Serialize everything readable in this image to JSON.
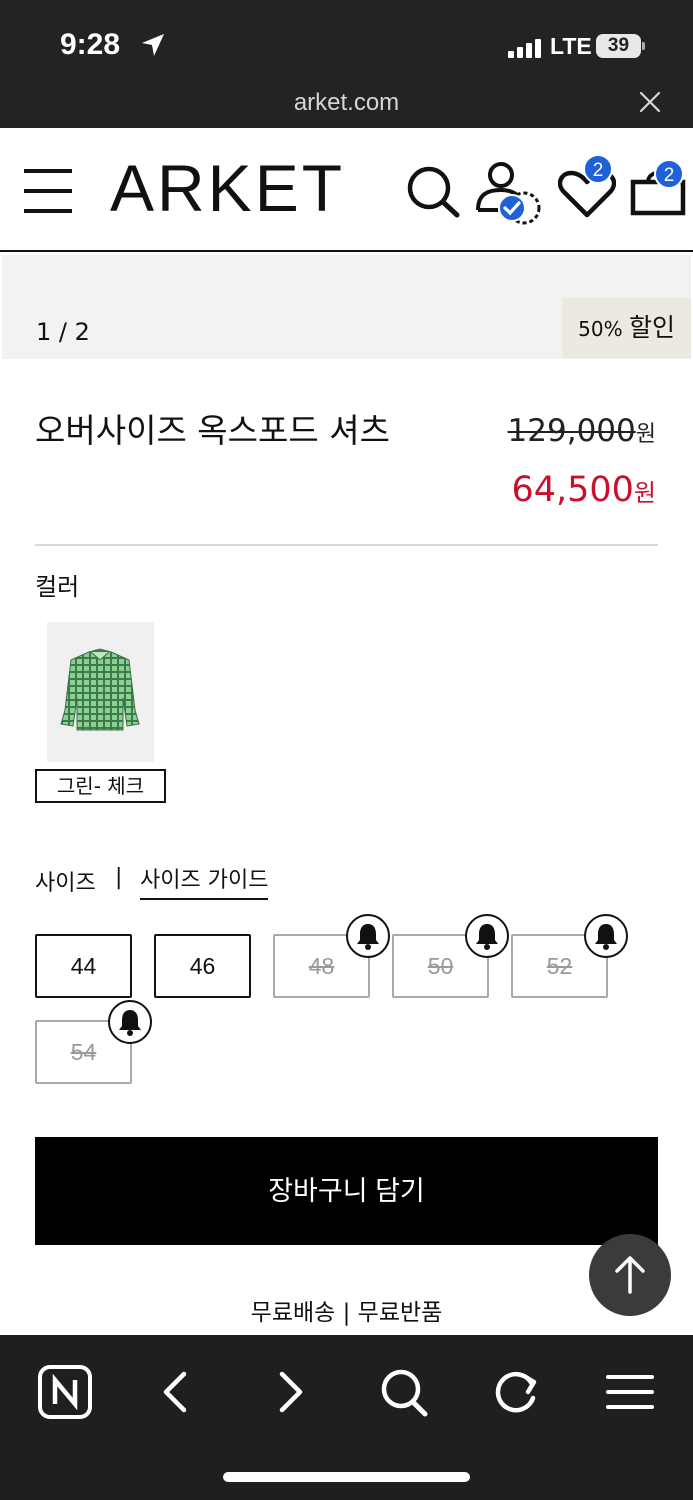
{
  "status_bar": {
    "time": "9:28",
    "network": "LTE",
    "battery": "39"
  },
  "browser": {
    "url": "arket.com"
  },
  "header": {
    "logo": "ARKET",
    "wishlist_count": "2",
    "cart_count": "2"
  },
  "gallery": {
    "counter": "1 / 2",
    "discount_percent": "50%",
    "discount_text": "할인"
  },
  "product": {
    "name": "오버사이즈 옥스포드 셔츠",
    "original_price": "129,000",
    "sale_price": "64,500",
    "currency": "원"
  },
  "color": {
    "label": "컬러",
    "selected": "그린- 체크"
  },
  "size": {
    "label": "사이즈",
    "separator": "|",
    "guide": "사이즈 가이드",
    "options": [
      {
        "label": "44",
        "available": true
      },
      {
        "label": "46",
        "available": true
      },
      {
        "label": "48",
        "available": false
      },
      {
        "label": "50",
        "available": false
      },
      {
        "label": "52",
        "available": false
      },
      {
        "label": "54",
        "available": false
      }
    ]
  },
  "actions": {
    "add_to_cart": "장바구니 담기",
    "shipping_info": "무료배송 | 무료반품"
  },
  "colors": {
    "sale_red": "#c8102e",
    "badge_blue": "#1f62d8"
  }
}
